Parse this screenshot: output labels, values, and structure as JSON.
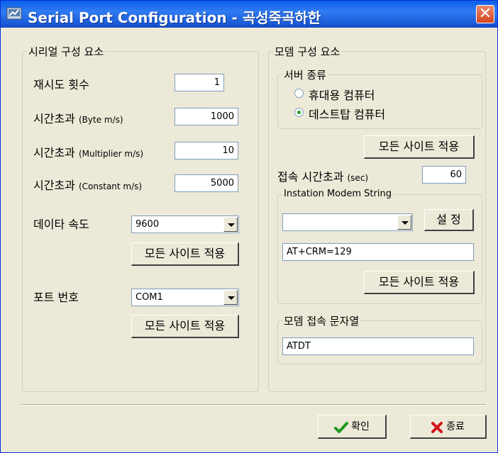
{
  "title": "Serial Port Configuration - 곡성죽곡하한",
  "serial": {
    "legend": "시리얼 구성 요소",
    "retry_label": "재시도 횟수",
    "retry_value": "1",
    "timeout_byte_main": "시간초과",
    "timeout_byte_unit": "(Byte m/s)",
    "timeout_byte_value": "1000",
    "timeout_mult_main": "시간초과",
    "timeout_mult_unit": "(Multiplier m/s)",
    "timeout_mult_value": "10",
    "timeout_const_main": "시간초과",
    "timeout_const_unit": "(Constant m/s)",
    "timeout_const_value": "5000",
    "baud_label": "데이타 속도",
    "baud_value": "9600",
    "apply_all_1": "모든 사이트 적용",
    "port_label": "포트 번호",
    "port_value": "COM1",
    "apply_all_2": "모든 사이트 적용"
  },
  "modem": {
    "legend": "모뎀 구성 요소",
    "server_legend": "서버 종류",
    "radio_portable": "휴대용 컴퓨터",
    "radio_desktop": "데스트탑 컴퓨터",
    "desktop_checked": true,
    "apply_all_3": "모든 사이트 적용",
    "connect_timeout_main": "접속 시간초과",
    "connect_timeout_unit": "(sec)",
    "connect_timeout_value": "60",
    "init_legend": "Instation Modem String",
    "init_combo_value": "",
    "set_button": "설 정",
    "init_string": "AT+CRM=129",
    "apply_all_4": "모든 사이트 적용",
    "dial_legend": "모뎀 접속 문자열",
    "dial_string": "ATDT"
  },
  "footer": {
    "ok_label": "확인",
    "exit_label": "종료"
  },
  "colors": {
    "titlebar": "#0A5FE8",
    "face": "#ECE9D8",
    "close": "#D6451E",
    "ok_check": "#1E9A1E",
    "exit_x": "#D0161B"
  },
  "icons": {
    "app": "serial-port-icon",
    "close": "close-icon",
    "ok": "checkmark-icon",
    "exit": "x-mark-icon"
  }
}
